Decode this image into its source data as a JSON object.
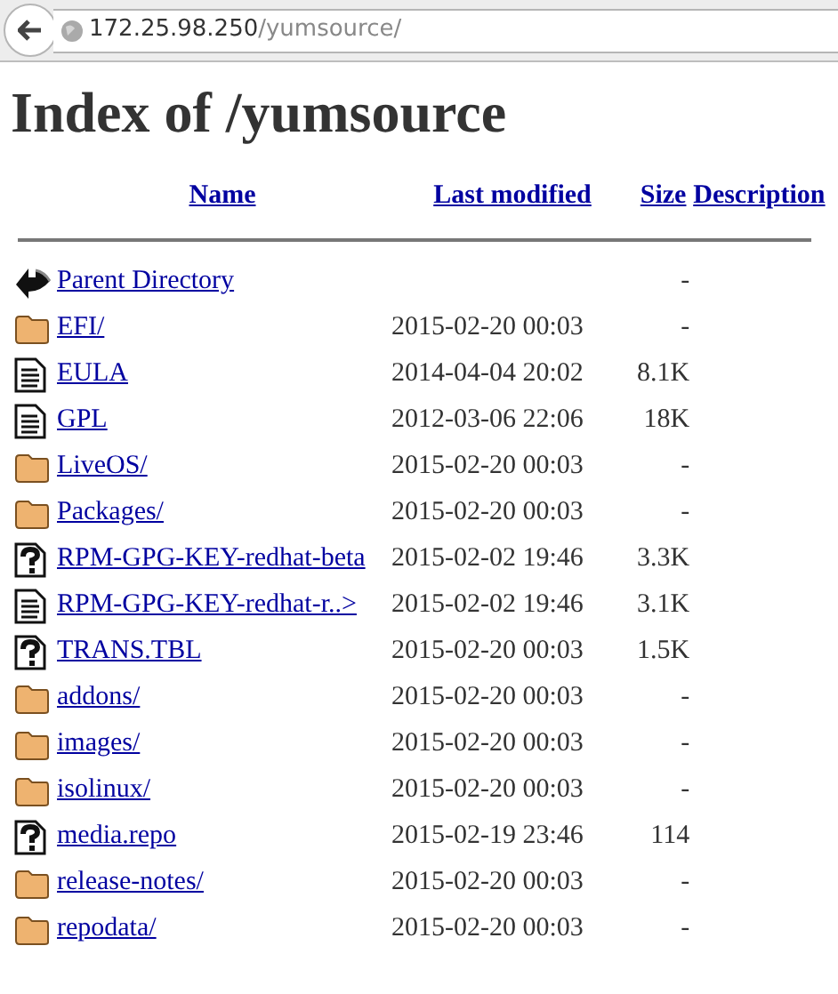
{
  "address_bar": {
    "host": "172.25.98.250",
    "path": "/yumsource/"
  },
  "heading": "Index of /yumsource",
  "table": {
    "columns": [
      "Name",
      "Last modified",
      "Size",
      "Description"
    ],
    "rows": [
      {
        "kind": "back",
        "name": "Parent Directory",
        "modified": "",
        "size": "-"
      },
      {
        "kind": "folder",
        "name": "EFI/",
        "modified": "2015-02-20 00:03",
        "size": "-"
      },
      {
        "kind": "text",
        "name": "EULA",
        "modified": "2014-04-04 20:02",
        "size": "8.1K"
      },
      {
        "kind": "text",
        "name": "GPL",
        "modified": "2012-03-06 22:06",
        "size": "18K"
      },
      {
        "kind": "folder",
        "name": "LiveOS/",
        "modified": "2015-02-20 00:03",
        "size": "-"
      },
      {
        "kind": "folder",
        "name": "Packages/",
        "modified": "2015-02-20 00:03",
        "size": "-"
      },
      {
        "kind": "unknown",
        "name": "RPM-GPG-KEY-redhat-beta",
        "modified": "2015-02-02 19:46",
        "size": "3.3K"
      },
      {
        "kind": "text",
        "name": "RPM-GPG-KEY-redhat-r..>",
        "modified": "2015-02-02 19:46",
        "size": "3.1K"
      },
      {
        "kind": "unknown",
        "name": "TRANS.TBL",
        "modified": "2015-02-20 00:03",
        "size": "1.5K"
      },
      {
        "kind": "folder",
        "name": "addons/",
        "modified": "2015-02-20 00:03",
        "size": "-"
      },
      {
        "kind": "folder",
        "name": "images/",
        "modified": "2015-02-20 00:03",
        "size": "-"
      },
      {
        "kind": "folder",
        "name": "isolinux/",
        "modified": "2015-02-20 00:03",
        "size": "-"
      },
      {
        "kind": "unknown",
        "name": "media.repo",
        "modified": "2015-02-19 23:46",
        "size": "114"
      },
      {
        "kind": "folder",
        "name": "release-notes/",
        "modified": "2015-02-20 00:03",
        "size": "-"
      },
      {
        "kind": "folder",
        "name": "repodata/",
        "modified": "2015-02-20 00:03",
        "size": "-"
      }
    ]
  }
}
